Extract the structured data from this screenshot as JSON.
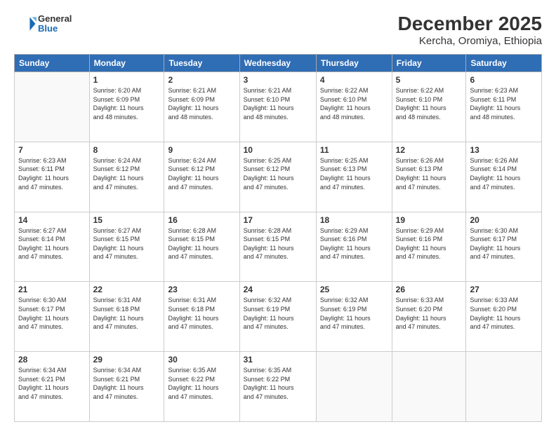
{
  "header": {
    "logo": {
      "general": "General",
      "blue": "Blue"
    },
    "title": "December 2025",
    "subtitle": "Kercha, Oromiya, Ethiopia"
  },
  "calendar": {
    "days_of_week": [
      "Sunday",
      "Monday",
      "Tuesday",
      "Wednesday",
      "Thursday",
      "Friday",
      "Saturday"
    ],
    "weeks": [
      [
        {
          "day": "",
          "info": ""
        },
        {
          "day": "1",
          "info": "Sunrise: 6:20 AM\nSunset: 6:09 PM\nDaylight: 11 hours\nand 48 minutes."
        },
        {
          "day": "2",
          "info": "Sunrise: 6:21 AM\nSunset: 6:09 PM\nDaylight: 11 hours\nand 48 minutes."
        },
        {
          "day": "3",
          "info": "Sunrise: 6:21 AM\nSunset: 6:10 PM\nDaylight: 11 hours\nand 48 minutes."
        },
        {
          "day": "4",
          "info": "Sunrise: 6:22 AM\nSunset: 6:10 PM\nDaylight: 11 hours\nand 48 minutes."
        },
        {
          "day": "5",
          "info": "Sunrise: 6:22 AM\nSunset: 6:10 PM\nDaylight: 11 hours\nand 48 minutes."
        },
        {
          "day": "6",
          "info": "Sunrise: 6:23 AM\nSunset: 6:11 PM\nDaylight: 11 hours\nand 48 minutes."
        }
      ],
      [
        {
          "day": "7",
          "info": "Sunrise: 6:23 AM\nSunset: 6:11 PM\nDaylight: 11 hours\nand 47 minutes."
        },
        {
          "day": "8",
          "info": "Sunrise: 6:24 AM\nSunset: 6:12 PM\nDaylight: 11 hours\nand 47 minutes."
        },
        {
          "day": "9",
          "info": "Sunrise: 6:24 AM\nSunset: 6:12 PM\nDaylight: 11 hours\nand 47 minutes."
        },
        {
          "day": "10",
          "info": "Sunrise: 6:25 AM\nSunset: 6:12 PM\nDaylight: 11 hours\nand 47 minutes."
        },
        {
          "day": "11",
          "info": "Sunrise: 6:25 AM\nSunset: 6:13 PM\nDaylight: 11 hours\nand 47 minutes."
        },
        {
          "day": "12",
          "info": "Sunrise: 6:26 AM\nSunset: 6:13 PM\nDaylight: 11 hours\nand 47 minutes."
        },
        {
          "day": "13",
          "info": "Sunrise: 6:26 AM\nSunset: 6:14 PM\nDaylight: 11 hours\nand 47 minutes."
        }
      ],
      [
        {
          "day": "14",
          "info": "Sunrise: 6:27 AM\nSunset: 6:14 PM\nDaylight: 11 hours\nand 47 minutes."
        },
        {
          "day": "15",
          "info": "Sunrise: 6:27 AM\nSunset: 6:15 PM\nDaylight: 11 hours\nand 47 minutes."
        },
        {
          "day": "16",
          "info": "Sunrise: 6:28 AM\nSunset: 6:15 PM\nDaylight: 11 hours\nand 47 minutes."
        },
        {
          "day": "17",
          "info": "Sunrise: 6:28 AM\nSunset: 6:15 PM\nDaylight: 11 hours\nand 47 minutes."
        },
        {
          "day": "18",
          "info": "Sunrise: 6:29 AM\nSunset: 6:16 PM\nDaylight: 11 hours\nand 47 minutes."
        },
        {
          "day": "19",
          "info": "Sunrise: 6:29 AM\nSunset: 6:16 PM\nDaylight: 11 hours\nand 47 minutes."
        },
        {
          "day": "20",
          "info": "Sunrise: 6:30 AM\nSunset: 6:17 PM\nDaylight: 11 hours\nand 47 minutes."
        }
      ],
      [
        {
          "day": "21",
          "info": "Sunrise: 6:30 AM\nSunset: 6:17 PM\nDaylight: 11 hours\nand 47 minutes."
        },
        {
          "day": "22",
          "info": "Sunrise: 6:31 AM\nSunset: 6:18 PM\nDaylight: 11 hours\nand 47 minutes."
        },
        {
          "day": "23",
          "info": "Sunrise: 6:31 AM\nSunset: 6:18 PM\nDaylight: 11 hours\nand 47 minutes."
        },
        {
          "day": "24",
          "info": "Sunrise: 6:32 AM\nSunset: 6:19 PM\nDaylight: 11 hours\nand 47 minutes."
        },
        {
          "day": "25",
          "info": "Sunrise: 6:32 AM\nSunset: 6:19 PM\nDaylight: 11 hours\nand 47 minutes."
        },
        {
          "day": "26",
          "info": "Sunrise: 6:33 AM\nSunset: 6:20 PM\nDaylight: 11 hours\nand 47 minutes."
        },
        {
          "day": "27",
          "info": "Sunrise: 6:33 AM\nSunset: 6:20 PM\nDaylight: 11 hours\nand 47 minutes."
        }
      ],
      [
        {
          "day": "28",
          "info": "Sunrise: 6:34 AM\nSunset: 6:21 PM\nDaylight: 11 hours\nand 47 minutes."
        },
        {
          "day": "29",
          "info": "Sunrise: 6:34 AM\nSunset: 6:21 PM\nDaylight: 11 hours\nand 47 minutes."
        },
        {
          "day": "30",
          "info": "Sunrise: 6:35 AM\nSunset: 6:22 PM\nDaylight: 11 hours\nand 47 minutes."
        },
        {
          "day": "31",
          "info": "Sunrise: 6:35 AM\nSunset: 6:22 PM\nDaylight: 11 hours\nand 47 minutes."
        },
        {
          "day": "",
          "info": ""
        },
        {
          "day": "",
          "info": ""
        },
        {
          "day": "",
          "info": ""
        }
      ]
    ]
  }
}
